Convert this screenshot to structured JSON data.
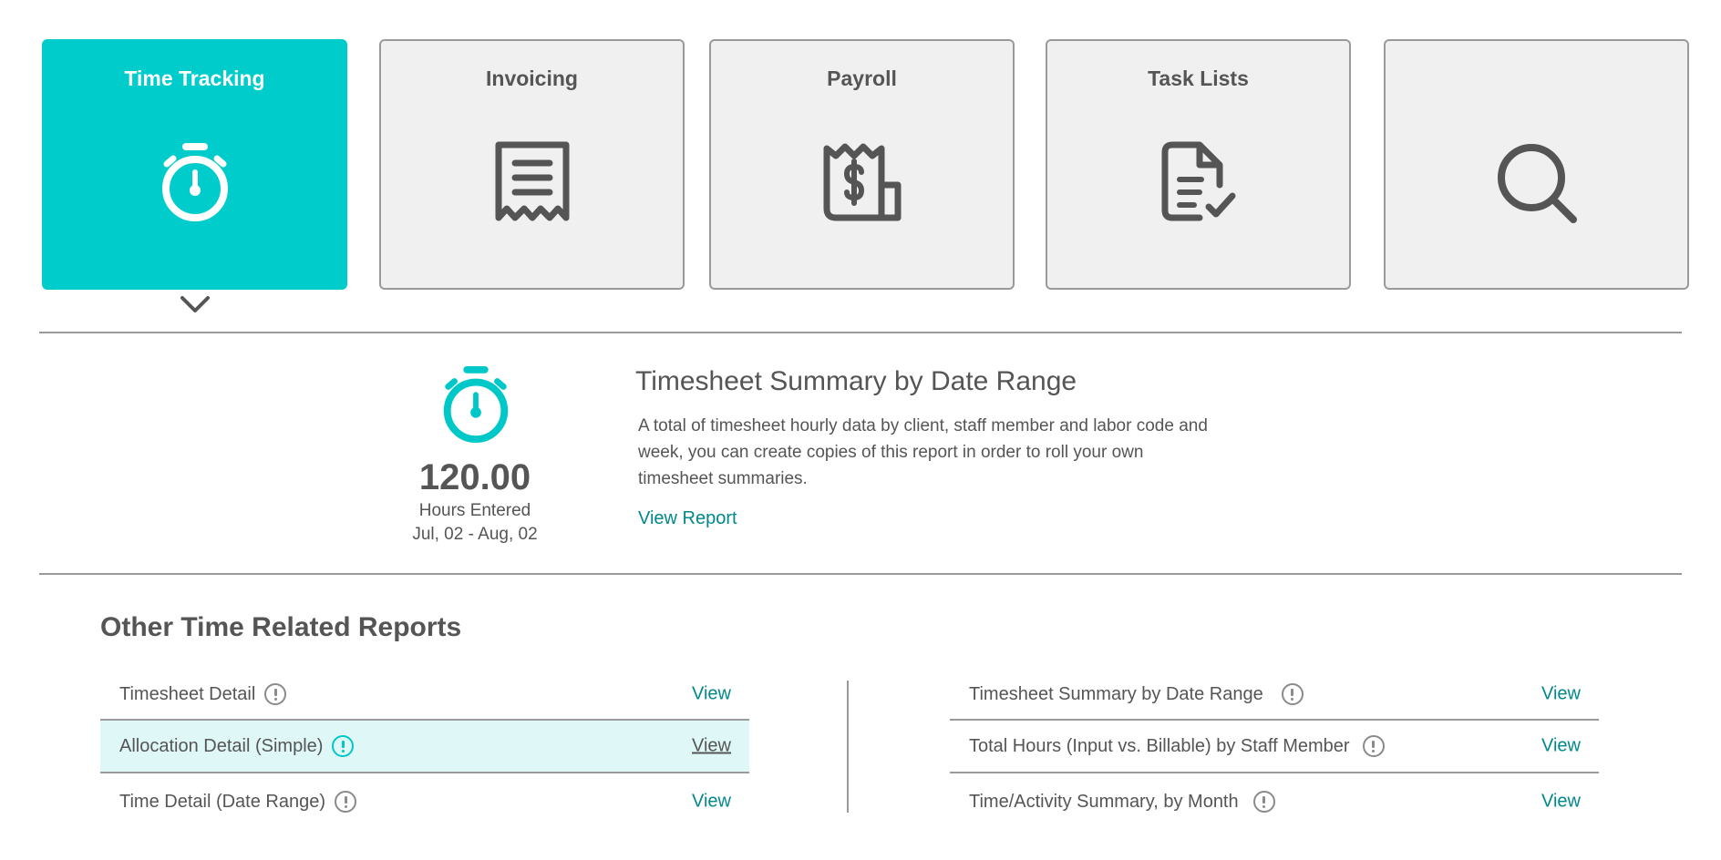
{
  "tabs": [
    {
      "label": "Time Tracking",
      "icon": "stopwatch-icon",
      "active": true
    },
    {
      "label": "Invoicing",
      "icon": "receipt-icon",
      "active": false
    },
    {
      "label": "Payroll",
      "icon": "payroll-receipt-icon",
      "active": false
    },
    {
      "label": "Task Lists",
      "icon": "document-check-icon",
      "active": false
    },
    {
      "label": "",
      "icon": "search-icon",
      "active": false
    }
  ],
  "summary": {
    "icon": "stopwatch-icon",
    "hours_value": "120.00",
    "hours_label": "Hours Entered",
    "date_range": "Jul, 02 - Aug, 02",
    "title": "Timesheet Summary by Date Range",
    "description": "A total of timesheet hourly data by client, staff member and labor code and week, you can create copies of this report in order to roll your own timesheet summaries.",
    "view_report_label": "View Report"
  },
  "other_reports": {
    "title": "Other Time Related Reports",
    "left": [
      {
        "label": "Timesheet Detail",
        "view": "View"
      },
      {
        "label": "Allocation Detail (Simple)",
        "view": "View",
        "highlighted": true
      },
      {
        "label": "Time Detail (Date Range)",
        "view": "View"
      }
    ],
    "right": [
      {
        "label": "Timesheet Summary by Date Range",
        "view": "View"
      },
      {
        "label": "Total Hours (Input vs. Billable) by Staff Member",
        "view": "View"
      },
      {
        "label": "Time/Activity Summary, by Month",
        "view": "View"
      }
    ]
  },
  "colors": {
    "accent": "#00cccc",
    "link": "#00888a",
    "text": "#555555",
    "tile_bg": "#f0f0f1",
    "highlight_row": "#dff7f7"
  }
}
